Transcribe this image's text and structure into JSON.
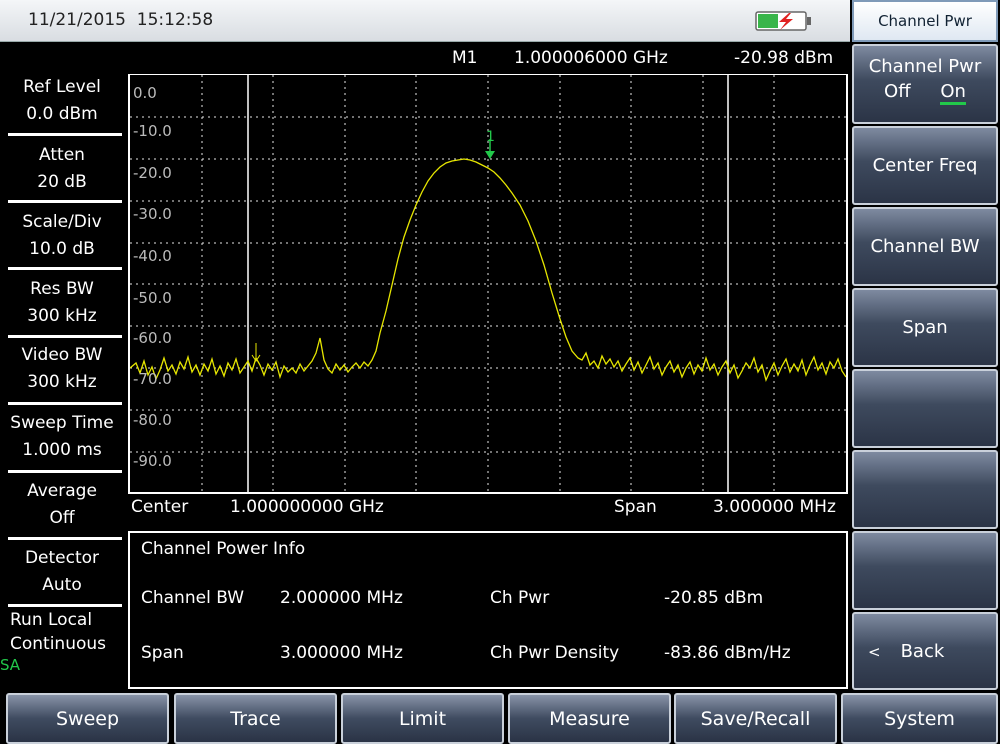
{
  "status": {
    "datetime": "11/21/2015  15:12:58"
  },
  "title": "Channel Pwr",
  "softkeys": {
    "channel_pwr": {
      "label": "Channel Pwr",
      "off": "Off",
      "on": "On"
    },
    "center_freq": "Center Freq",
    "channel_bw": "Channel BW",
    "span": "Span",
    "back": {
      "arrow": "<",
      "label": "Back"
    }
  },
  "params": [
    {
      "label": "Ref Level",
      "value": "0.0 dBm"
    },
    {
      "label": "Atten",
      "value": "20 dB"
    },
    {
      "label": "Scale/Div",
      "value": "10.0 dB"
    },
    {
      "label": "Res BW",
      "value": "300 kHz"
    },
    {
      "label": "Video BW",
      "value": "300 kHz"
    },
    {
      "label": "Sweep Time",
      "value": "1.000 ms"
    },
    {
      "label": "Average",
      "value": "Off"
    },
    {
      "label": "Detector",
      "value": "Auto"
    }
  ],
  "run": {
    "line1": "Run  Local",
    "line2": "Continuous",
    "mode": "SA"
  },
  "marker": {
    "name": "M1",
    "freq": "1.000006000 GHz",
    "level": "-20.98 dBm",
    "label": "1"
  },
  "axis": {
    "y_ticks": [
      "0.0",
      "-10.0",
      "-20.0",
      "-30.0",
      "-40.0",
      "-50.0",
      "-60.0",
      "-70.0",
      "-80.0",
      "-90.0"
    ],
    "center_label": "Center",
    "center_value": "1.000000000 GHz",
    "span_label": "Span",
    "span_value": "3.000000 MHz"
  },
  "info": {
    "title": "Channel Power Info",
    "channel_bw_label": "Channel BW",
    "channel_bw_value": "2.000000 MHz",
    "ch_pwr_label": "Ch Pwr",
    "ch_pwr_value": "-20.85 dBm",
    "span_label": "Span",
    "span_value": "3.000000 MHz",
    "density_label": "Ch Pwr Density",
    "density_value": "-83.86 dBm/Hz"
  },
  "menu": [
    "Sweep",
    "Trace",
    "Limit",
    "Measure",
    "Save/Recall",
    "System"
  ],
  "colors": {
    "trace": "#e6e600",
    "marker": "#22c84a",
    "on_underline": "#22c84a"
  }
}
